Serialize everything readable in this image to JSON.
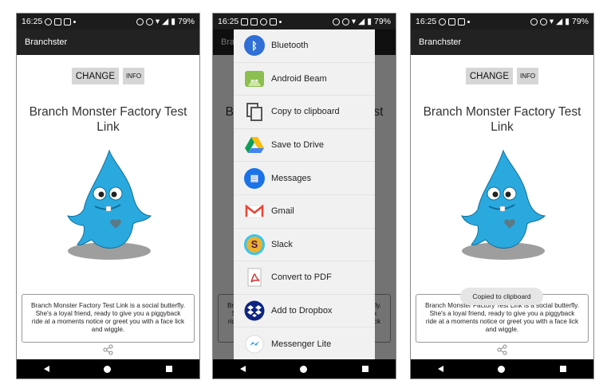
{
  "status": {
    "time": "16:25",
    "battery": "79%"
  },
  "app": {
    "title": "Branchster"
  },
  "buttons": {
    "change": "CHANGE",
    "info": "INFO"
  },
  "monster": {
    "name": "Branch Monster Factory Test Link",
    "description": "Branch Monster Factory Test Link is a social butterfly. She's a loyal friend, ready to give you a piggyback ride at a moments notice or greet you with a face lick and wiggle."
  },
  "share_sheet": {
    "items": [
      {
        "label": "Bluetooth",
        "icon": "bluetooth-icon"
      },
      {
        "label": "Android Beam",
        "icon": "android-beam-icon"
      },
      {
        "label": "Copy to clipboard",
        "icon": "copy-icon"
      },
      {
        "label": "Save to Drive",
        "icon": "drive-icon"
      },
      {
        "label": "Messages",
        "icon": "messages-icon"
      },
      {
        "label": "Gmail",
        "icon": "gmail-icon"
      },
      {
        "label": "Slack",
        "icon": "slack-icon"
      },
      {
        "label": "Convert to PDF",
        "icon": "pdf-icon"
      },
      {
        "label": "Add to Dropbox",
        "icon": "dropbox-icon"
      },
      {
        "label": "Messenger Lite",
        "icon": "messenger-lite-icon"
      }
    ]
  },
  "toast": {
    "text": "Copied to clipboard"
  },
  "colors": {
    "monster": "#2aa9df",
    "appbar": "#222222"
  }
}
